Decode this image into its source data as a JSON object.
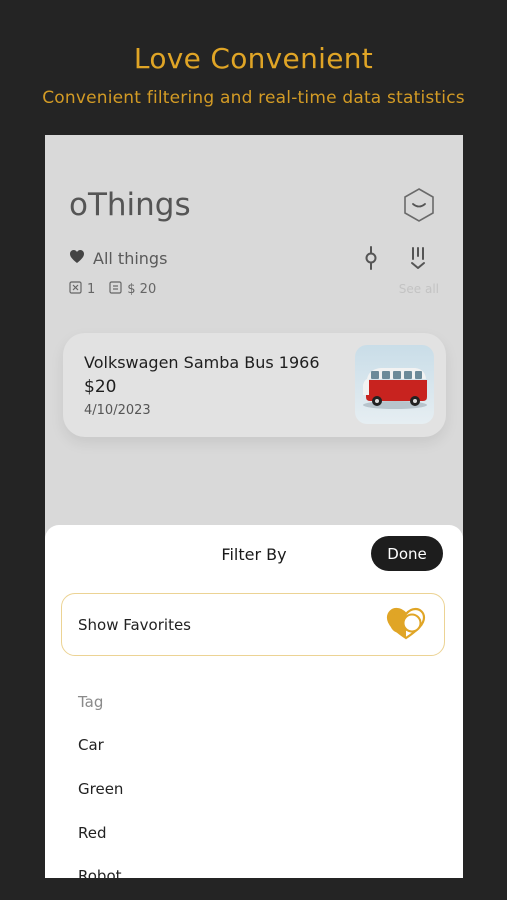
{
  "promo": {
    "title": "Love Convenient",
    "subtitle": "Convenient filtering and real-time data statistics"
  },
  "app": {
    "title": "oThings",
    "filter_label": "All things",
    "stats": {
      "count": "1",
      "total": "$ 20"
    },
    "see_all": "See all"
  },
  "card": {
    "name": "Volkswagen Samba Bus 1966",
    "price": "$20",
    "date": "4/10/2023"
  },
  "sheet": {
    "title": "Filter By",
    "done_label": "Done",
    "show_favorites_label": "Show Favorites",
    "show_favorites_on": true,
    "tag_header": "Tag",
    "tags": [
      "Car",
      "Green",
      "Red",
      "Robot"
    ]
  },
  "colors": {
    "accent": "#e0a526",
    "background": "#242424",
    "fav_border": "#ecd394"
  }
}
